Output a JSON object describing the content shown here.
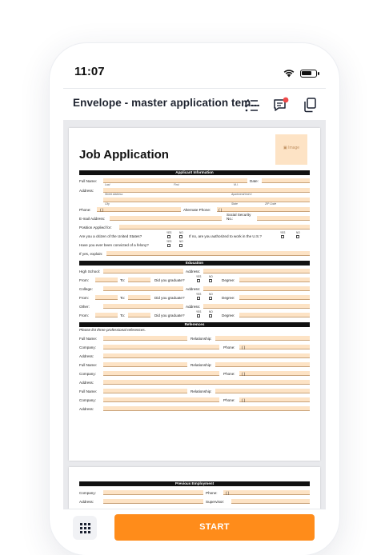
{
  "status": {
    "time": "11:07"
  },
  "header": {
    "title": "Envelope - master application tem..."
  },
  "image_label": "Image",
  "doc": {
    "title": "Job Application",
    "applicant_header": "Applicant Information",
    "full_name": "Full Name:",
    "date": "Date:",
    "last": "Last",
    "first": "First",
    "mi": "M.I.",
    "address": "Address:",
    "street": "Street Address",
    "apt": "Apartment/Unit #",
    "city": "City",
    "state": "State",
    "zip": "ZIP Code",
    "phone": "Phone:",
    "alt_phone": "Alternate Phone:",
    "phone_paren": "(     )",
    "email": "E-mail Address:",
    "ssn": "Social Security No.:",
    "position": "Position Applied for:",
    "citizen": "Are you a citizen of the United States?",
    "authorized": "If no, are you authorized to work in the U.S.?",
    "felony": "Have you ever been convicted of a felony?",
    "explain": "If yes, explain:",
    "yes": "YES",
    "no": "NO",
    "education_header": "Education",
    "high_school": "High School:",
    "from": "From:",
    "to": "To:",
    "graduate": "Did you graduate?",
    "degree": "Degree:",
    "college": "College:",
    "other": "Other:",
    "references_header": "References",
    "references_note": "Please list three professional references.",
    "relationship": "Relationship:",
    "company": "Company:",
    "employment_header": "Previous Employment",
    "supervisor": "Supervisor:"
  },
  "footer": {
    "start": "START"
  }
}
